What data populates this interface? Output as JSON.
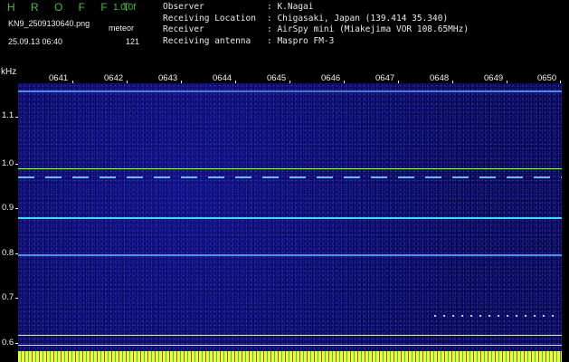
{
  "header": {
    "title": "H R O F F T",
    "version": "1.0.0f",
    "filename": "KN9_2509130640.png",
    "meteor_label": "meteor",
    "datetime": "25.09.13 06:40",
    "count": "121"
  },
  "info": [
    {
      "label": "Observer",
      "value": ": K.Nagai"
    },
    {
      "label": "Receiving Location",
      "value": ": Chigasaki, Japan (139.414 35.340)"
    },
    {
      "label": "Receiver",
      "value": ": AirSpy mini (Miakejima VOR 108.65MHz)"
    },
    {
      "label": "Receiving antenna",
      "value": ": Maspro FM-3"
    }
  ],
  "axis": {
    "y_unit": "kHz",
    "y_ticks": [
      "1.1",
      "1.0",
      "0.9",
      "0.8",
      "0.7",
      "0.6"
    ],
    "x_ticks": [
      "0641",
      "0642",
      "0643",
      "0644",
      "0645",
      "0646",
      "0647",
      "0648",
      "0649",
      "0650"
    ]
  },
  "colors": {
    "title_green": "#3fbf3f",
    "background": "#000000",
    "spectrogram_blue": "#07074a",
    "signal_cyan": "#40d8ff",
    "signal_green": "#a0ff60",
    "bottom_yellow": "#ffff00"
  }
}
